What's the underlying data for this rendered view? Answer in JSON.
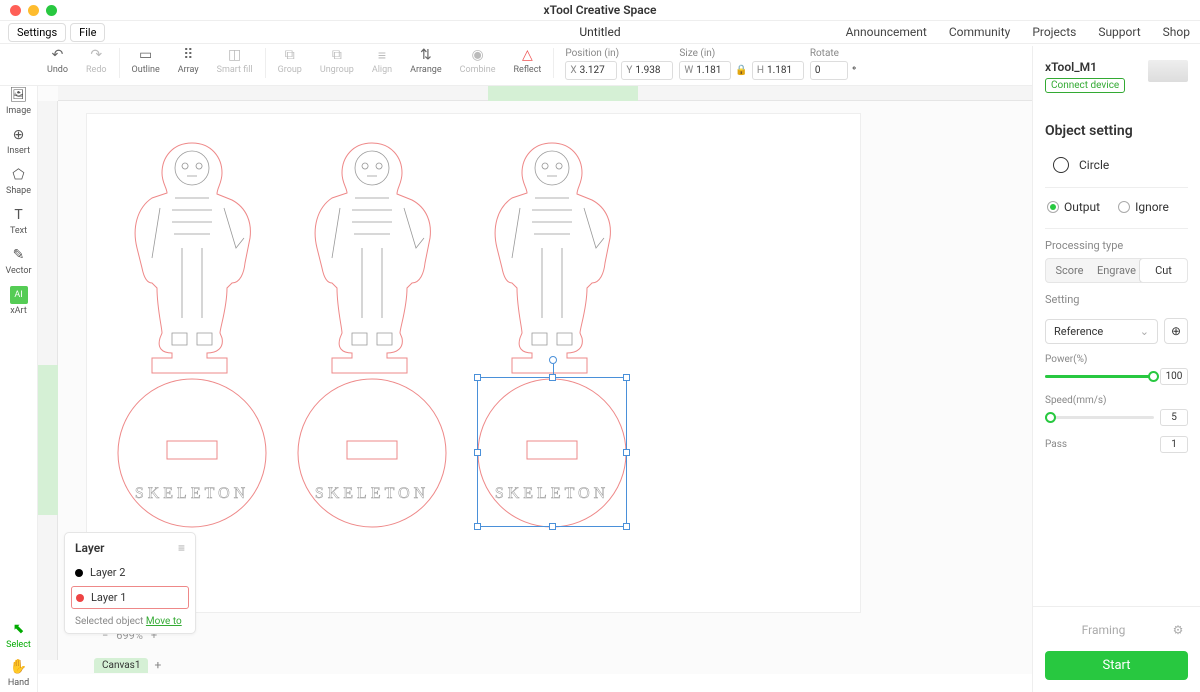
{
  "window": {
    "title": "xTool Creative Space"
  },
  "menu": {
    "settings": "Settings",
    "file": "File",
    "doc": "Untitled",
    "links": [
      "Announcement",
      "Community",
      "Projects",
      "Support",
      "Shop"
    ]
  },
  "sidebar": {
    "items": [
      {
        "label": "Image",
        "icon": "🖼"
      },
      {
        "label": "Insert",
        "icon": "⊕"
      },
      {
        "label": "Shape",
        "icon": "▱"
      },
      {
        "label": "Text",
        "icon": "T"
      },
      {
        "label": "Vector",
        "icon": "✎"
      },
      {
        "label": "xArt",
        "icon": "AI"
      }
    ],
    "bottom": [
      {
        "label": "Select",
        "icon": "⬉"
      },
      {
        "label": "Hand",
        "icon": "✋"
      }
    ]
  },
  "toolbar": {
    "groups": [
      {
        "label": "Undo",
        "icon": "↶"
      },
      {
        "label": "Redo",
        "icon": "↷"
      },
      {
        "label": "Outline",
        "icon": "▭"
      },
      {
        "label": "Array",
        "icon": "⠿"
      },
      {
        "label": "Smart fill",
        "icon": "◫"
      },
      {
        "label": "Group",
        "icon": "⧉"
      },
      {
        "label": "Ungroup",
        "icon": "⧉"
      },
      {
        "label": "Align",
        "icon": "≡"
      },
      {
        "label": "Arrange",
        "icon": "⇅"
      },
      {
        "label": "Combine",
        "icon": "◉"
      },
      {
        "label": "Reflect",
        "icon": "△"
      }
    ],
    "props": {
      "pos_label": "Position (in)",
      "x": "3.127",
      "y": "1.938",
      "size_label": "Size (in)",
      "w": "1.181",
      "h": "1.181",
      "rot_label": "Rotate",
      "rot": "0"
    }
  },
  "canvas": {
    "label_text": "SKELETON",
    "tabs": [
      "Canvas1"
    ]
  },
  "zoom": {
    "value": "699%"
  },
  "layer": {
    "title": "Layer",
    "items": [
      {
        "name": "Layer 2",
        "color": "#000"
      },
      {
        "name": "Layer 1",
        "color": "#e44"
      }
    ],
    "footer_pre": "Selected object ",
    "footer_link": "Move to"
  },
  "device": {
    "name": "xTool_M1",
    "connect": "Connect device"
  },
  "objset": {
    "title": "Object setting",
    "shape": "Circle",
    "output": "Output",
    "ignore": "Ignore",
    "proc_label": "Processing type",
    "proc_opts": [
      "Score",
      "Engrave",
      "Cut"
    ],
    "setting_label": "Setting",
    "reference": "Reference",
    "power_label": "Power(%)",
    "power_val": "100",
    "speed_label": "Speed(mm/s)",
    "speed_val": "5",
    "pass_label": "Pass",
    "pass_val": "1"
  },
  "footer": {
    "framing": "Framing",
    "start": "Start"
  }
}
